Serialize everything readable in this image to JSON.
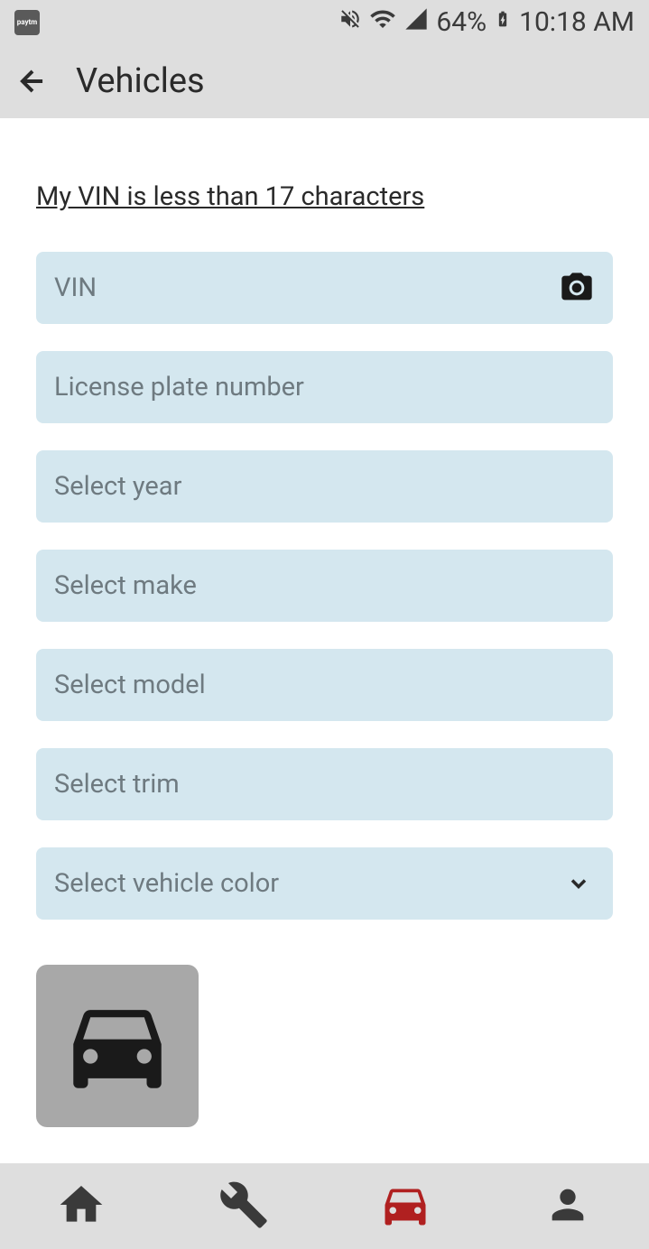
{
  "status_bar": {
    "app_badge": "paytm",
    "battery_pct": "64%",
    "time": "10:18 AM"
  },
  "header": {
    "title": "Vehicles"
  },
  "form": {
    "vin_link": "My VIN is less than 17 characters",
    "vin_placeholder": "VIN",
    "license_placeholder": "License plate number",
    "year_placeholder": "Select year",
    "make_placeholder": "Select make",
    "model_placeholder": "Select model",
    "trim_placeholder": "Select trim",
    "color_placeholder": "Select vehicle color"
  }
}
